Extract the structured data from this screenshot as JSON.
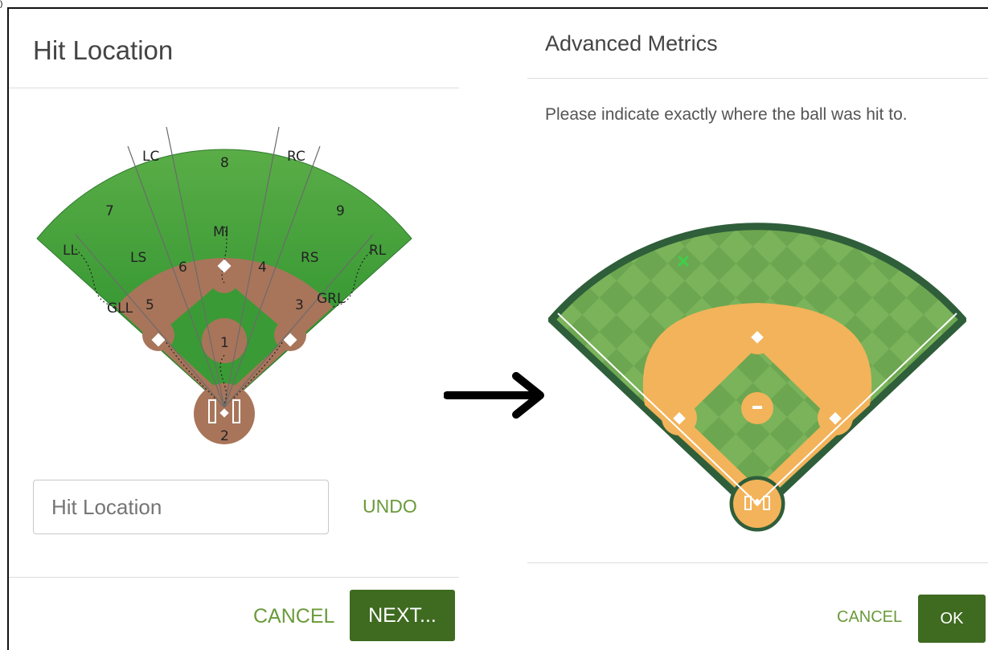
{
  "left_dialog": {
    "title": "Hit Location",
    "field_labels": {
      "lc": "LC",
      "eight": "8",
      "rc": "RC",
      "seven": "7",
      "nine": "9",
      "mi": "MI",
      "ll": "LL",
      "ls": "LS",
      "six": "6",
      "four": "4",
      "rs": "RS",
      "rl": "RL",
      "gll": "GLL",
      "five": "5",
      "three": "3",
      "grl": "GRL",
      "one": "1",
      "two": "2"
    },
    "hit_location_input": {
      "value": "",
      "placeholder": "Hit Location"
    },
    "undo_label": "UNDO",
    "cancel_label": "CANCEL",
    "next_label": "NEXT..."
  },
  "right_dialog": {
    "title": "Advanced Metrics",
    "prompt": "Please indicate exactly where the ball was hit to.",
    "cancel_label": "CANCEL",
    "ok_label": "OK"
  },
  "corner_mark": ")",
  "colors": {
    "accent_text": "#6a9a3a",
    "primary_button": "#3e6b20",
    "grass_left": "#3a9a35",
    "dirt_left": "#a8755a",
    "grass_right": "#7ab35a",
    "dirt_right": "#f2b35a",
    "field_border_right": "#2f5e3a",
    "hit_marker": "#3fd04a"
  }
}
